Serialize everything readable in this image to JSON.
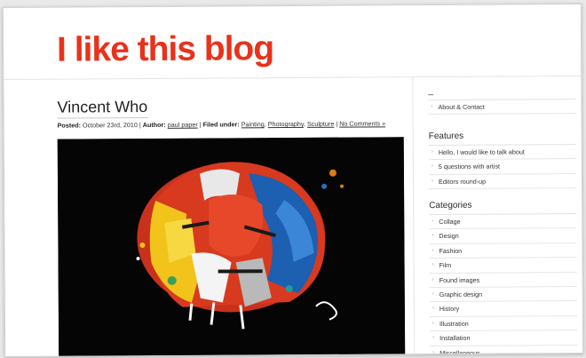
{
  "blog": {
    "title": "I like this blog"
  },
  "post": {
    "title": "Vincent Who",
    "meta": {
      "posted_label": "Posted:",
      "date": "October 23rd, 2010",
      "author_label": "Author:",
      "author": "paul paper",
      "filed_label": "Filed under:",
      "categories": [
        "Painting",
        "Photography",
        "Sculpture"
      ],
      "comments": "No Comments »"
    },
    "image": {
      "description_icon": "colorful-paint-splash-head-image"
    }
  },
  "sidebar": {
    "pages_heading": "_",
    "pages": [
      "About & Contact"
    ],
    "features_heading": "Features",
    "features": [
      "Hello, I would like to talk about",
      "5 questions with artist",
      "Editors round-up"
    ],
    "categories_heading": "Categories",
    "categories": [
      "Collage",
      "Design",
      "Fashion",
      "Film",
      "Found images",
      "Graphic design",
      "History",
      "Illustration",
      "Installation",
      "Miscellaneous"
    ]
  },
  "colors": {
    "brand": "#e8321c",
    "text": "#333333",
    "rule": "#e4e4e4"
  }
}
